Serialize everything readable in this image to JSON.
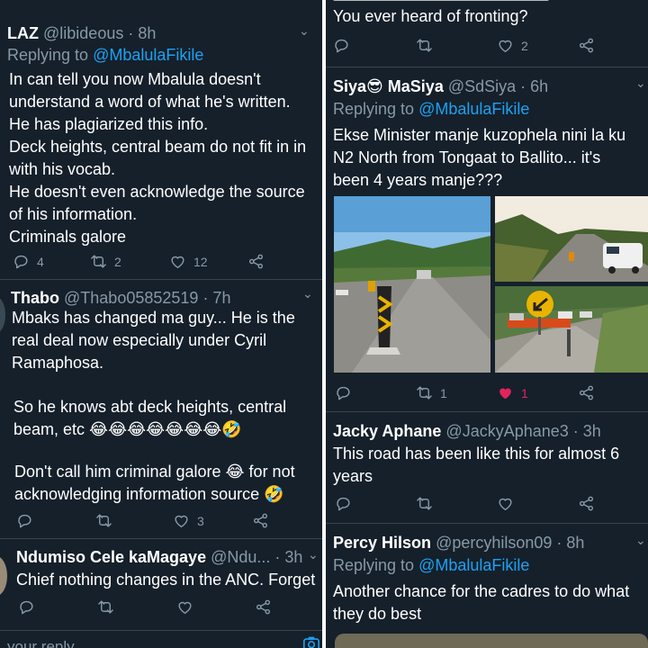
{
  "left": {
    "tweets": [
      {
        "name": "LAZ",
        "handle": "@libideous",
        "time": "· 8h",
        "replying_prefix": "Replying to ",
        "replying_to": "@MbalulaFikile",
        "text": "In can tell you now Mbalula doesn't\nunderstand a word of what he's written.\nHe has plagiarized this info.\nDeck heights, central beam do not fit in in\nwith his vocab.\nHe doesn't even acknowledge the source\nof his information.\nCriminals galore",
        "replies": "4",
        "retweets": "2",
        "likes": "12"
      },
      {
        "name": "Thabo",
        "handle": "@Thabo05852519",
        "time": "· 7h",
        "text_1": "Mbaks has changed ma guy... He is the\nreal deal now especially under Cyril\nRamaphosa.",
        "text_2": "So he knows abt deck heights, central\nbeam, etc 😂😂😂😂😂😂😂🤣",
        "text_3": "Don't call him criminal galore 😂 for not\nacknowledging information source 🤣",
        "replies": "",
        "retweets": "",
        "likes": "3"
      },
      {
        "name": "Ndumiso Cele kaMagaye",
        "handle": "@Ndu...",
        "time": "· 3h",
        "text": "Chief nothing changes in the ANC. Forget",
        "replies": "",
        "retweets": "",
        "likes": ""
      }
    ],
    "reply_placeholder": "your reply"
  },
  "right": {
    "top_partial": {
      "text": "You ever heard of fronting?",
      "likes": "2"
    },
    "tweets": [
      {
        "name": "Siya😎 MaSiya",
        "handle": "@SdSiya",
        "time": "· 6h",
        "replying_prefix": "Replying to ",
        "replying_to": "@MbalulaFikile",
        "text": "Ekse Minister manje kuzophela nini la ku\nN2 North from Tongaat to Ballito... it's\nbeen 4 years manje???",
        "retweets": "1",
        "likes": "1"
      },
      {
        "name": "Jacky Aphane",
        "handle": "@JackyAphane3",
        "time": "· 3h",
        "text": "This road has been like this for almost 6\nyears"
      },
      {
        "name": "Percy Hilson",
        "handle": "@percyhilson09",
        "time": "· 8h",
        "replying_prefix": "Replying to ",
        "replying_to": "@MbalulaFikile",
        "text": "Another chance for the cadres to do what\nthey do best"
      }
    ]
  },
  "colors": {
    "background": "#15202b",
    "text": "#ffffff",
    "muted": "#8899a6",
    "mention": "#1da1f2",
    "like_active": "#e0245e",
    "separator": "#38444d"
  },
  "icons": [
    "reply-icon",
    "retweet-icon",
    "like-icon",
    "share-icon",
    "chevron-down-icon",
    "camera-icon"
  ]
}
